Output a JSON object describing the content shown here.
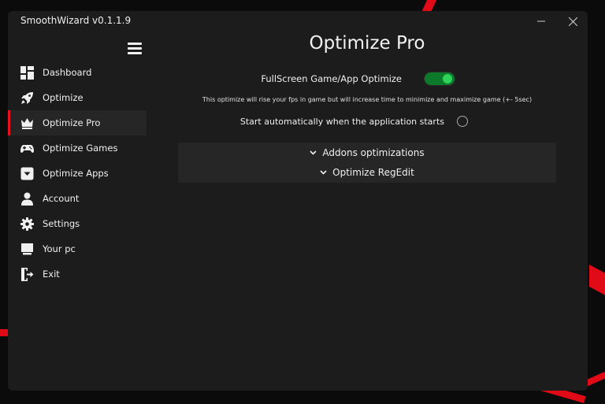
{
  "app": {
    "title": "SmoothWizard v0.1.1.9"
  },
  "window_controls": {
    "minimize": "minimize-icon",
    "close": "close-icon"
  },
  "sidebar": {
    "items": [
      {
        "label": "Dashboard",
        "icon": "dashboard-icon",
        "active": false
      },
      {
        "label": "Optimize",
        "icon": "rocket-icon",
        "active": false
      },
      {
        "label": "Optimize Pro",
        "icon": "crown-icon",
        "active": true
      },
      {
        "label": "Optimize Games",
        "icon": "gamepad-icon",
        "active": false
      },
      {
        "label": "Optimize Apps",
        "icon": "dropdown-box-icon",
        "active": false
      },
      {
        "label": "Account",
        "icon": "person-icon",
        "active": false
      },
      {
        "label": "Settings",
        "icon": "gear-icon",
        "active": false
      },
      {
        "label": "Your pc",
        "icon": "monitor-icon",
        "active": false
      },
      {
        "label": "Exit",
        "icon": "exit-icon",
        "active": false
      }
    ]
  },
  "main": {
    "title": "Optimize Pro",
    "fullscreen_option": {
      "label": "FullScreen Game/App Optimize",
      "enabled": true,
      "description": "This optimize will rise your fps in game but will increase time to minimize and maximize game (+- 5sec)"
    },
    "auto_start": {
      "label": "Start automatically when the application starts",
      "checked": false
    },
    "expanders": [
      {
        "label": "Addons optimizations"
      },
      {
        "label": "Optimize RegEdit"
      }
    ]
  },
  "colors": {
    "accent": "#e81123",
    "toggle_on": "#0b7a2a",
    "toggle_knob": "#2fd35a",
    "window_bg": "#1c1c1c"
  }
}
